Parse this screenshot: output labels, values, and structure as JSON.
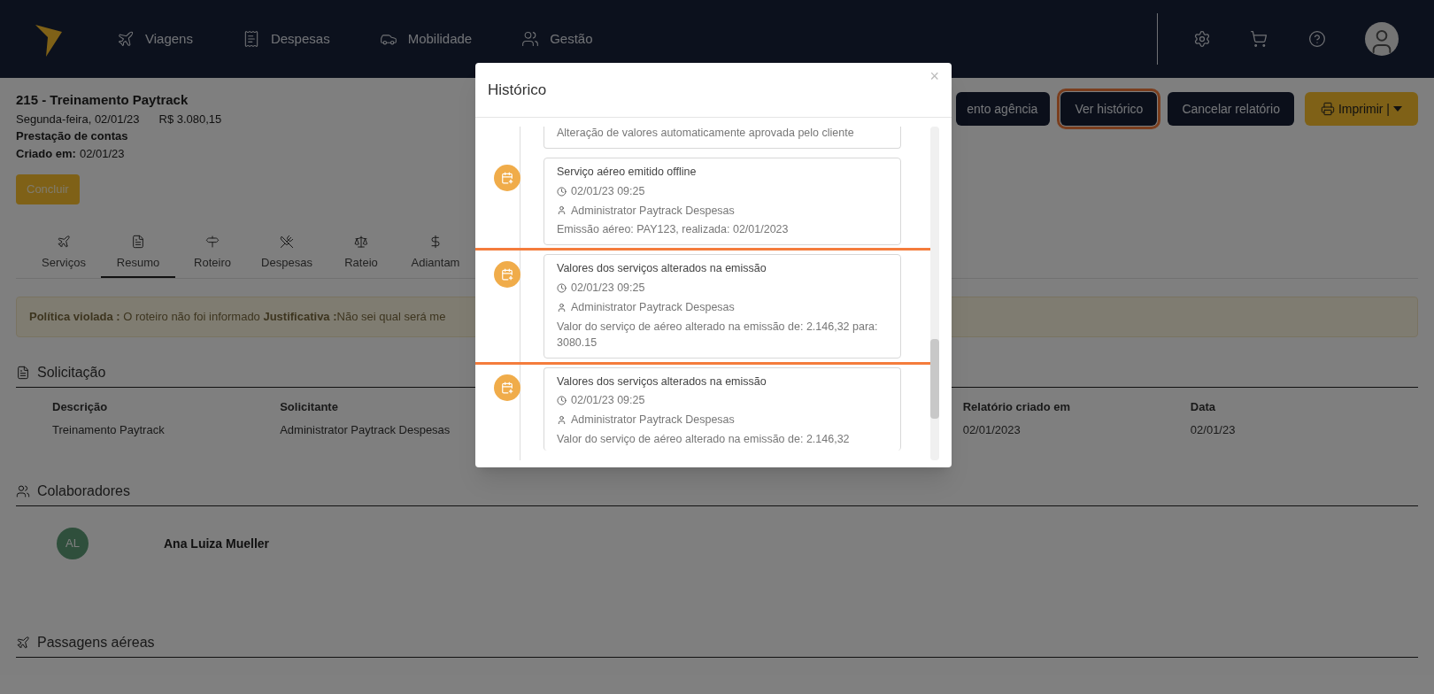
{
  "navbar": {
    "items": [
      {
        "label": "Viagens"
      },
      {
        "label": "Despesas"
      },
      {
        "label": "Mobilidade"
      },
      {
        "label": "Gestão"
      }
    ]
  },
  "report": {
    "title": "215 - Treinamento Paytrack",
    "date": "Segunda-feira, 02/01/23",
    "amount": "R$ 3.080,15",
    "type": "Prestação de contas",
    "created_label": "Criado em:",
    "created_value": "02/01/23",
    "conclude_button": "Concluir"
  },
  "actions": [
    {
      "label": "ento agência",
      "kind": "dark",
      "highlighted": false
    },
    {
      "label": "Ver histórico",
      "kind": "dark",
      "highlighted": true
    },
    {
      "label": "Cancelar relatório",
      "kind": "dark",
      "highlighted": false
    },
    {
      "label": "Imprimir |",
      "kind": "print",
      "highlighted": false
    }
  ],
  "tabs": [
    {
      "label": "Serviços",
      "selected": false
    },
    {
      "label": "Resumo",
      "selected": true
    },
    {
      "label": "Roteiro",
      "selected": false
    },
    {
      "label": "Despesas",
      "selected": false
    },
    {
      "label": "Rateio",
      "selected": false
    },
    {
      "label": "Adiantam",
      "selected": false
    }
  ],
  "alert": "**Política violada :** O roteiro não foi informado **Justificativa :**Não sei qual será me",
  "solicitation": {
    "title": "Solicitação",
    "fields": [
      {
        "label": "Descrição",
        "value": "Treinamento Paytrack"
      },
      {
        "label": "Solicitante",
        "value": "Administrator Paytrack Despesas"
      },
      {
        "label": "Relatório criado em",
        "value": "02/01/2023"
      },
      {
        "label": "Data",
        "value": "02/01/23"
      }
    ]
  },
  "collaborators": {
    "title": "Colaboradores",
    "people": [
      {
        "initials": "AL",
        "name": "Ana Luiza Mueller"
      }
    ]
  },
  "flights": {
    "title": "Passagens aéreas"
  },
  "modal": {
    "title": "Histórico",
    "close": "×",
    "entries": [
      {
        "description": "Alteração de valores automaticamente aprovada pelo cliente",
        "highlighted": false
      },
      {
        "title": "Serviço aéreo emitido offline",
        "time": "02/01/23 09:25",
        "user": "Administrator Paytrack Despesas",
        "description": "Emissão aéreo: PAY123, realizada: 02/01/2023",
        "highlighted": false
      },
      {
        "title": "Valores dos serviços alterados na emissão",
        "time": "02/01/23 09:25",
        "user": "Administrator Paytrack Despesas",
        "description": "Valor do serviço de aéreo alterado na emissão de: 2.146,32 para: 3080.15",
        "highlighted": true
      },
      {
        "title": "Valores dos serviços alterados na emissão",
        "time": "02/01/23 09:25",
        "user": "Administrator Paytrack Despesas",
        "description": "Valor do serviço de aéreo alterado na emissão de: 2.146,32",
        "highlighted": false
      }
    ]
  }
}
